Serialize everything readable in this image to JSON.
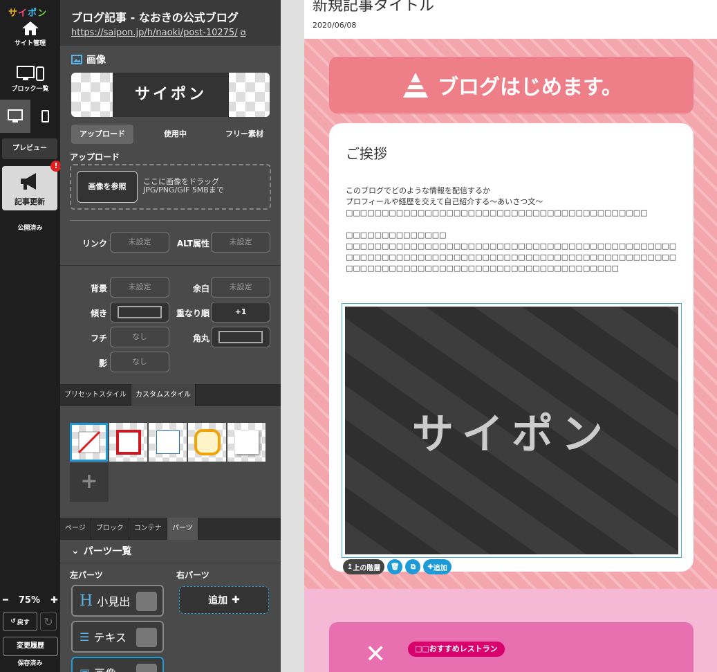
{
  "rail": {
    "logo": "サイポン",
    "site_manage": "サイト管理",
    "block_list": "ブロック一覧",
    "preview": "プレビュー",
    "update": "記事更新",
    "badge": "!",
    "published": "公開済み",
    "zoom": "75%",
    "undo": "戻す",
    "history": "変更履歴",
    "saved": "保存済み"
  },
  "header": {
    "title": "ブログ記事 - なおきの公式ブログ",
    "url": "https://saipon.jp/h/naoki/post-10275/"
  },
  "image_section": {
    "title": "画像",
    "preview_text": "サイポン",
    "tabs": [
      "アップロード",
      "使用中",
      "フリー素材"
    ],
    "upload_label": "アップロード",
    "browse_button": "画像を参照",
    "drop_hint_line1": "ここに画像をドラッグ",
    "drop_hint_line2": "JPG/PNG/GIF 5MBまで"
  },
  "fields": {
    "link_label": "リンク",
    "link_value": "未設定",
    "alt_label": "ALT属性",
    "alt_value": "未設定",
    "bg_label": "背景",
    "bg_value": "未設定",
    "margin_label": "余白",
    "margin_value": "未設定",
    "tilt_label": "傾き",
    "order_label": "重なり順",
    "order_value": "+1",
    "border_label": "フチ",
    "border_value": "なし",
    "radius_label": "角丸",
    "shadow_label": "影",
    "shadow_value": "なし"
  },
  "style_tabs": [
    "プリセットスタイル",
    "カスタムスタイル"
  ],
  "bottom_tabs": [
    "ページ",
    "ブロック",
    "コンテナ",
    "パーツ"
  ],
  "parts": {
    "title": "パーツ一覧",
    "left_label": "左パーツ",
    "right_label": "右パーツ",
    "items": [
      "小見出",
      "テキス",
      "画像"
    ],
    "add": "追加"
  },
  "article": {
    "title": "新規記事タイトル",
    "date": "2020/06/08",
    "banner": "ブログはじめます。",
    "heading": "ご挨拶",
    "body": [
      "このブログでどのような情報を配信するか",
      "プロフィールや経歴を交えて自己紹介する～あいさつ文～",
      "□□□□□□□□□□□□□□□□□□□□□□□□□□□□□□□□□□□□□□□□□□",
      "",
      "□□□□□□□□□□□□□□",
      "□□□□□□□□□□□□□□□□□□□□□□□□□□□□□□□□□□□□□□□□□□□□□□□□□□□□□□□□□□□□□□□□□□□□□□□□□□□□□□□□□□□□□□□□□□□□□□□□□□□□□□□□□□□□□□□□□□□□□□□□□□□□□□□□□□"
    ],
    "image_text": "サイポン",
    "toolbar": {
      "up": "上の階層",
      "add": "追加"
    },
    "restaurant_tag": "□□おすすめレストラン"
  },
  "colors": {
    "accent": "#1e9bd7",
    "badge": "#e02020",
    "pink": "#f4a6ad",
    "banner": "#ee7f89"
  }
}
